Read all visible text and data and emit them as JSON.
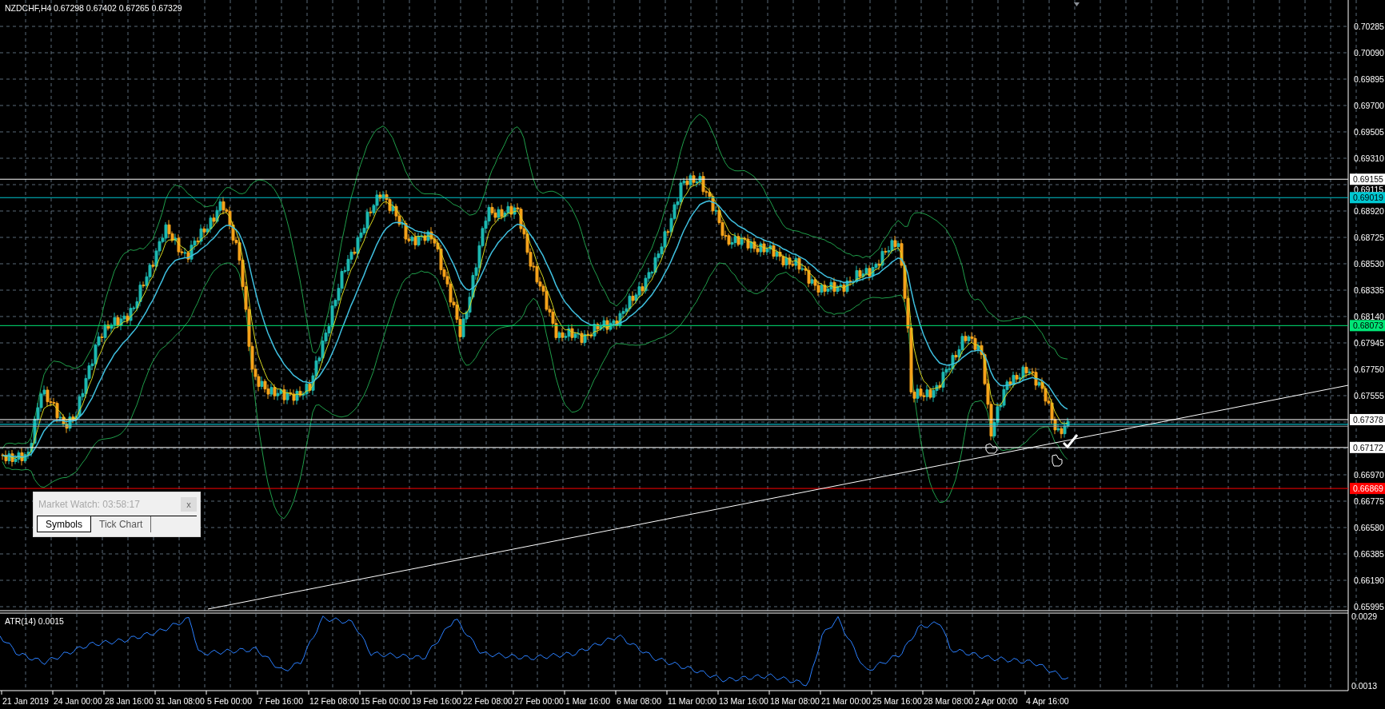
{
  "chart": {
    "symbol": "NZDCHF,H4",
    "quotes": "0.67298 0.67402 0.67265 0.67329"
  },
  "price_axis": [
    "0.70285",
    "0.70090",
    "0.69895",
    "0.69700",
    "0.69505",
    "0.69310",
    "0.69115",
    "0.68920",
    "0.68725",
    "0.68530",
    "0.68335",
    "0.68140",
    "0.67945",
    "0.67750",
    "0.67555",
    "0.66970",
    "0.66775",
    "0.66580",
    "0.66385",
    "0.66190",
    "0.65995"
  ],
  "levels": [
    {
      "price": "0.69155",
      "color": "#ffffff"
    },
    {
      "price": "0.69019",
      "color": "#00c8d2"
    },
    {
      "price": "0.68073",
      "color": "#00e676"
    },
    {
      "price": "0.67378",
      "color": "#ffffff"
    },
    {
      "price": "0.67172",
      "color": "#ffffff"
    },
    {
      "price": "0.66869",
      "color": "#ff0000"
    }
  ],
  "indicator": {
    "label": "ATR(14) 0.0015",
    "axis": [
      "0.0029",
      "0.0013"
    ]
  },
  "time_axis": [
    "21 Jan 2019",
    "24 Jan 00:00",
    "28 Jan 16:00",
    "31 Jan 08:00",
    "5 Feb 00:00",
    "7 Feb 16:00",
    "12 Feb 08:00",
    "15 Feb 00:00",
    "19 Feb 16:00",
    "22 Feb 08:00",
    "27 Feb 00:00",
    "1 Mar 16:00",
    "6 Mar 08:00",
    "11 Mar 00:00",
    "13 Mar 16:00",
    "18 Mar 08:00",
    "21 Mar 00:00",
    "25 Mar 16:00",
    "28 Mar 08:00",
    "2 Apr 00:00",
    "4 Apr 16:00"
  ],
  "market_watch": {
    "title": "Market Watch: 03:58:17",
    "close": "x",
    "tabs": [
      {
        "label": "Symbols",
        "selected": true
      },
      {
        "label": "Tick Chart",
        "selected": false
      }
    ]
  }
}
